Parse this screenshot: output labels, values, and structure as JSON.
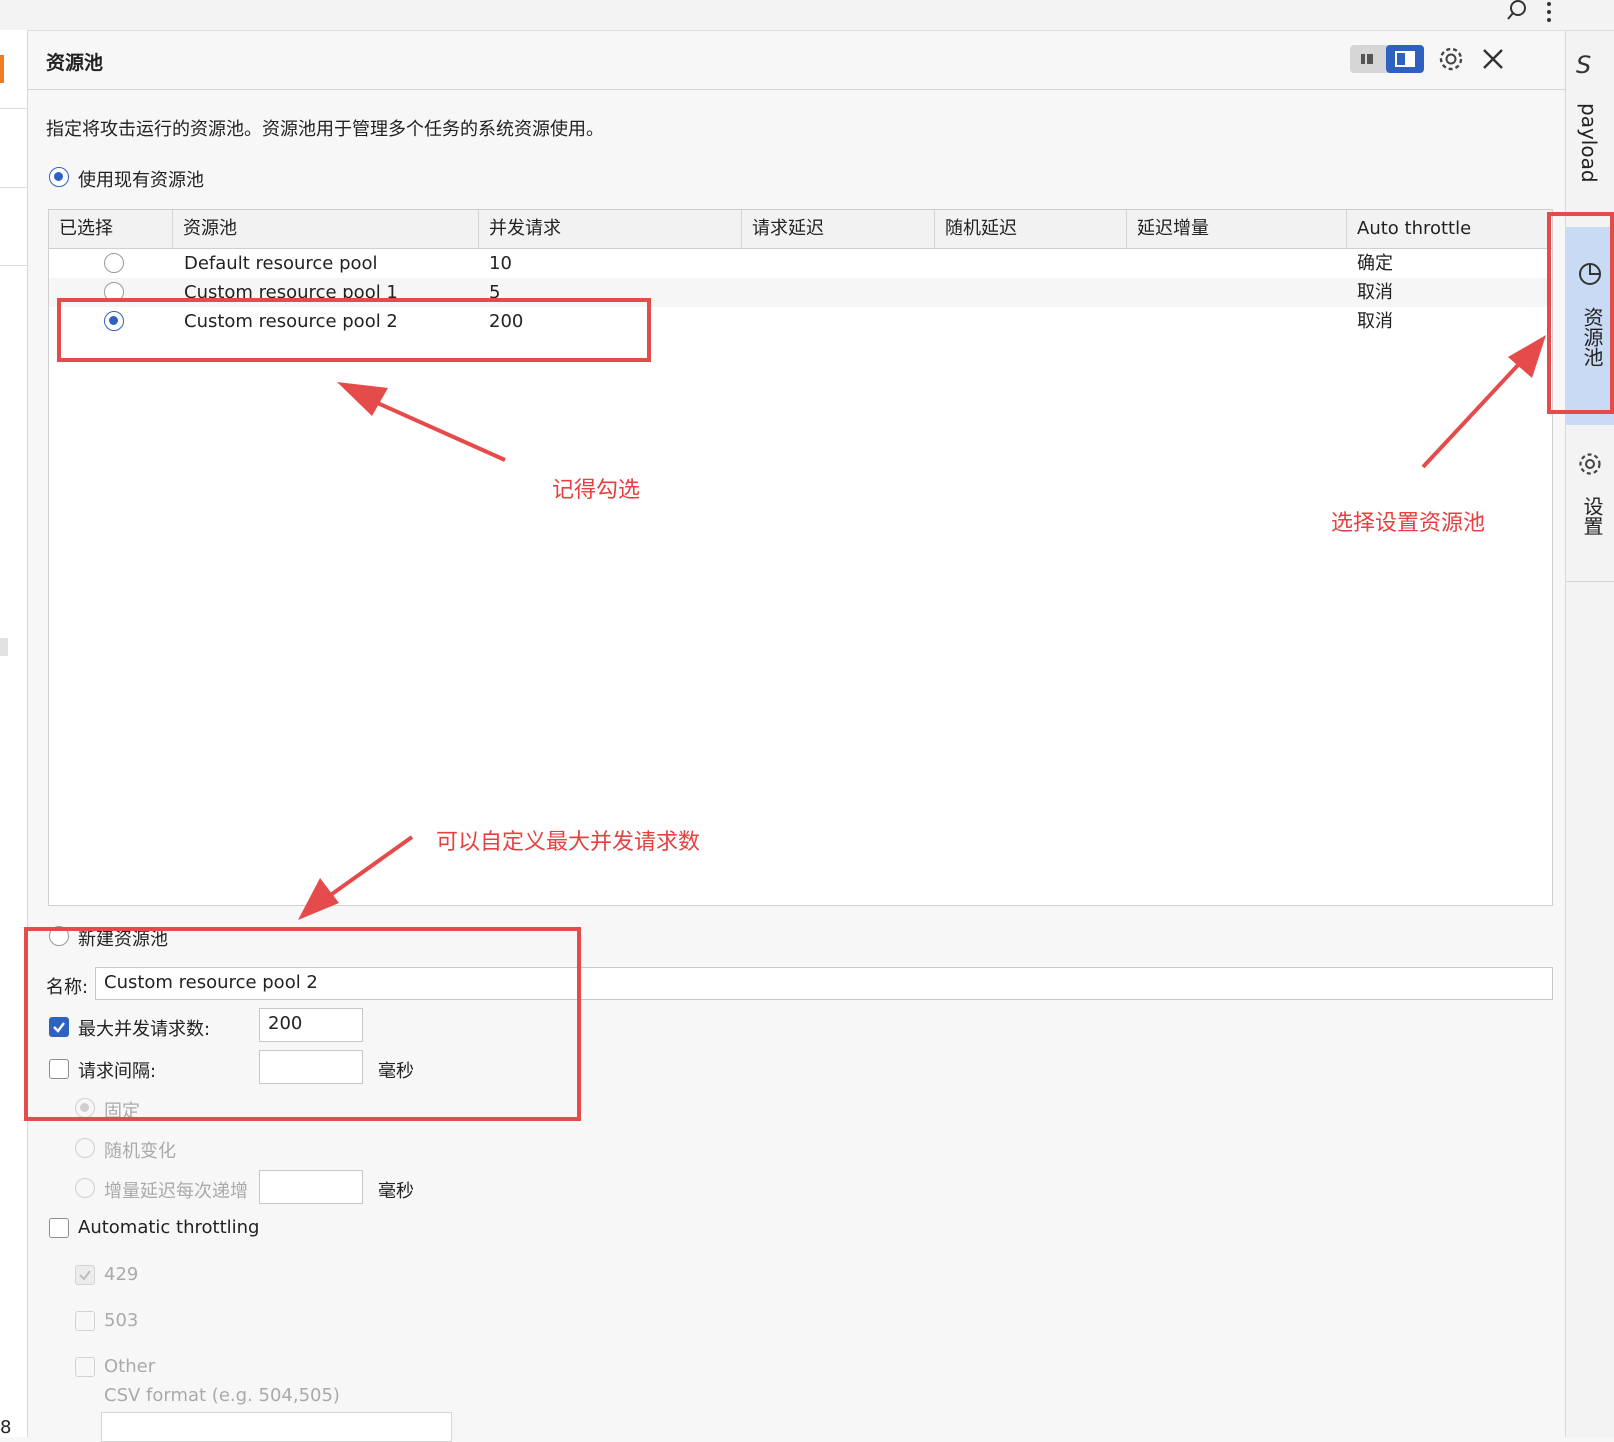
{
  "panel": {
    "title": "资源池",
    "description": "指定将攻击运行的资源池。资源池用于管理多个任务的系统资源使用。",
    "use_existing_label": "使用现有资源池",
    "create_new_label": "新建资源池"
  },
  "table": {
    "headers": [
      "已选择",
      "资源池",
      "并发请求",
      "请求延迟",
      "随机延迟",
      "延迟增量",
      "Auto throttle"
    ],
    "rows": [
      {
        "selected": false,
        "name": "Default resource pool",
        "concurrent": "10",
        "auto_throttle": "确定"
      },
      {
        "selected": false,
        "name": "Custom resource pool 1",
        "concurrent": "5",
        "auto_throttle": "取消"
      },
      {
        "selected": true,
        "name": "Custom resource pool 2",
        "concurrent": "200",
        "auto_throttle": "取消"
      }
    ]
  },
  "form": {
    "name_label": "名称:",
    "name_value": "Custom resource pool 2",
    "max_concurrent_label": "最大并发请求数:",
    "max_concurrent_value": "200",
    "max_concurrent_checked": true,
    "interval_label": "请求间隔:",
    "interval_value": "",
    "interval_unit": "毫秒",
    "fixed_label": "固定",
    "random_label": "随机变化",
    "increase_label": "增量延迟每次递增",
    "increase_unit": "毫秒",
    "auto_throttling_label": "Automatic throttling",
    "code_429": "429",
    "code_503": "503",
    "other_label": "Other",
    "csv_hint": "CSV format (e.g. 504,505)"
  },
  "rightbar": {
    "payload_label": "payload",
    "resource_pool_label": "资源池",
    "settings_label": "设置"
  },
  "left_edge_text": "8",
  "annotations": {
    "remember_check": "记得勾选",
    "select_setting": "选择设置资源池",
    "custom_max": "可以自定义最大并发请求数"
  },
  "colors": {
    "accent": "#2f62c0",
    "annotation": "#e64b4b",
    "selected_tab_bg": "#c9daf4"
  }
}
